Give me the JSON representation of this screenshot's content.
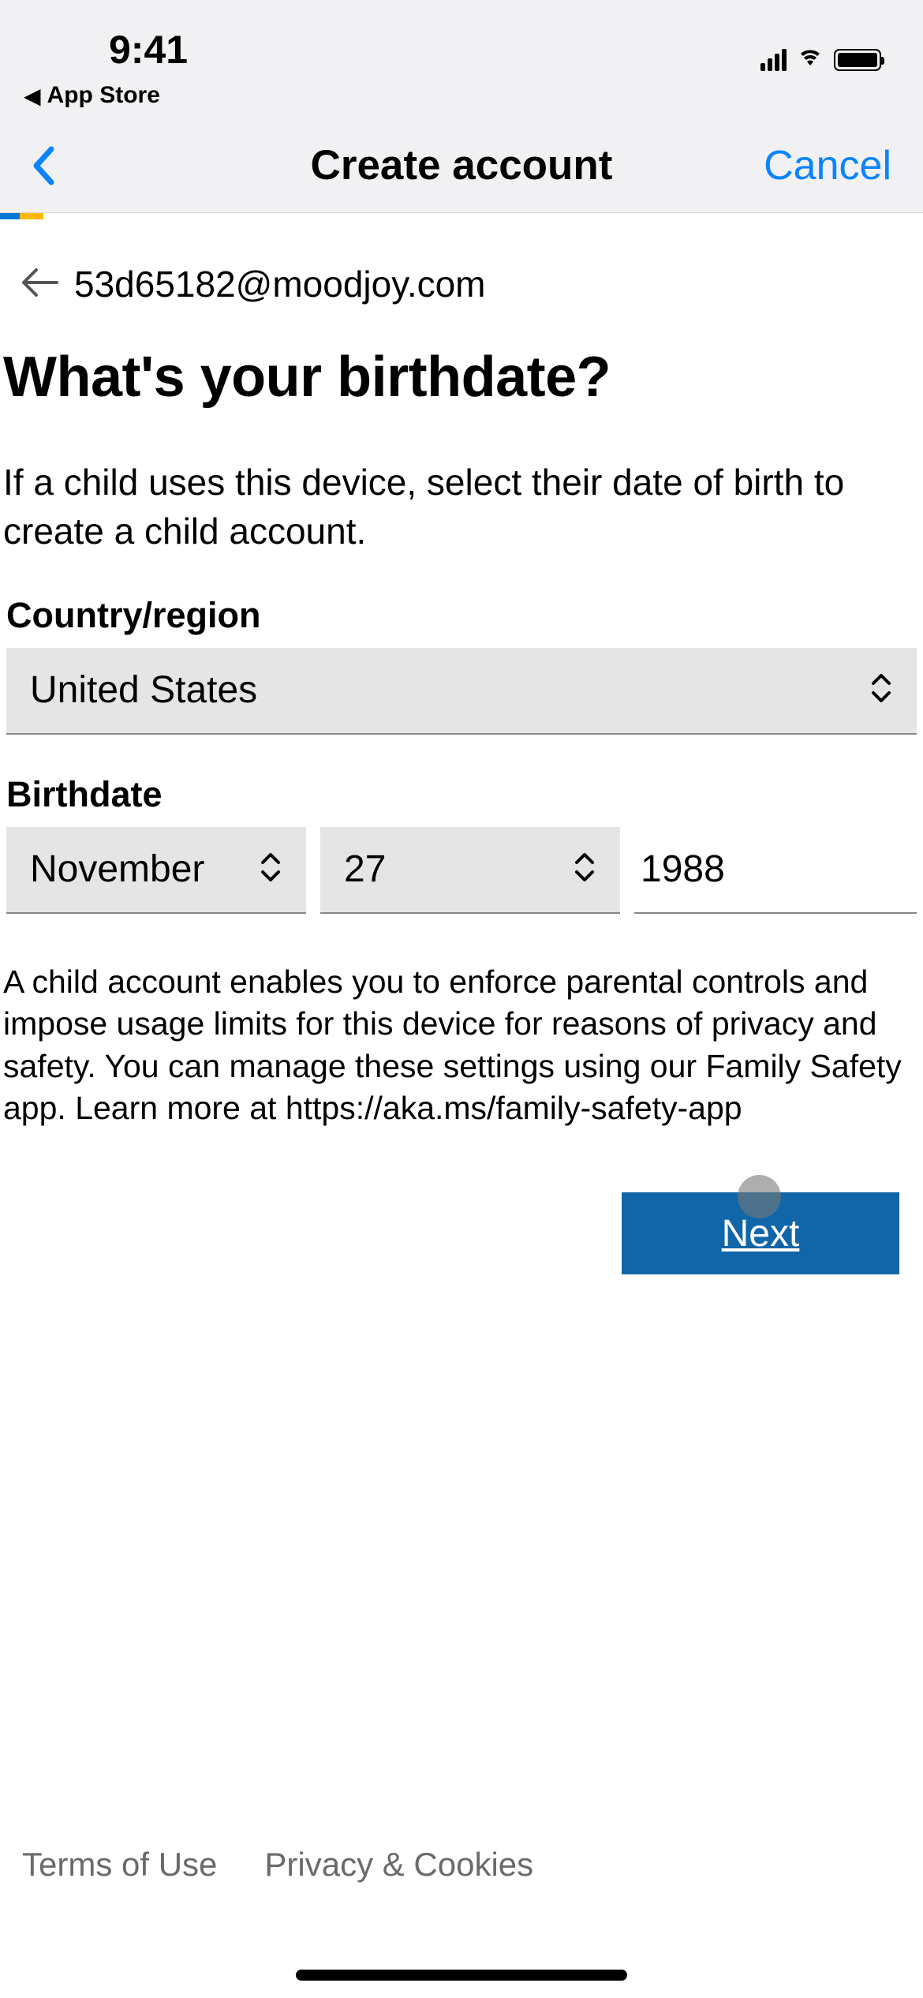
{
  "statusBar": {
    "time": "9:41"
  },
  "backToApp": {
    "label": "App Store"
  },
  "navBar": {
    "title": "Create account",
    "cancel": "Cancel"
  },
  "email": "53d65182@moodjoy.com",
  "heading": "What's your birthdate?",
  "subheading": "If a child uses this device, select their date of birth to create a child account.",
  "countryField": {
    "label": "Country/region",
    "value": "United States"
  },
  "birthdateField": {
    "label": "Birthdate",
    "month": "November",
    "day": "27",
    "year": "1988"
  },
  "infoText": "A child account enables you to enforce parental controls and impose usage limits for this device for reasons of privacy and safety. You can manage these settings using our Family Safety app. Learn more at https://aka.ms/family-safety-app",
  "nextButton": "Next",
  "footer": {
    "terms": "Terms of Use",
    "privacy": "Privacy & Cookies"
  }
}
